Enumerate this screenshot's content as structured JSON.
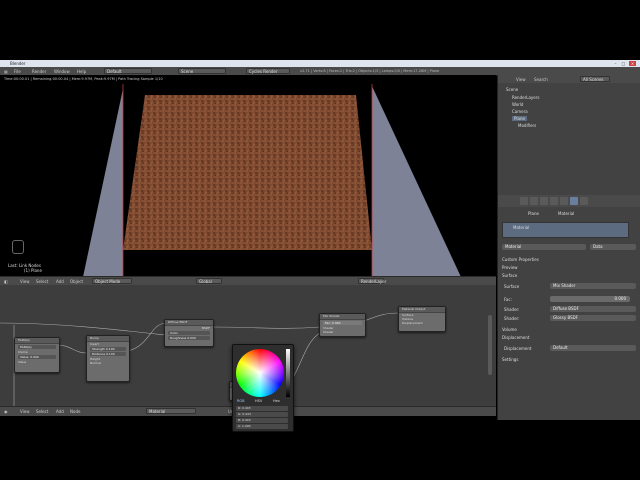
{
  "window": {
    "title": "Blender"
  },
  "topbar": {
    "menus": [
      "File",
      "Render",
      "Window",
      "Help"
    ],
    "layout": "Default",
    "scene": "Scene",
    "engine": "Cycles Render",
    "stats": "v2.71 | Verts:8 | Faces:1 | Tris:2 | Objects:1/3 | Lamps:0/0 | Mem:17.28M | Plane"
  },
  "viewport": {
    "info_line": "Time:00:00.01 | Remaining:00:00.04 | Mem:9.97M, Peak:9.97M | Path Tracing Sample 1/10",
    "last_op": "Last: Link Nodes",
    "object_label": "(1) Plane",
    "header": {
      "menus": [
        "View",
        "Select",
        "Add",
        "Object"
      ],
      "mode": "Object Mode",
      "pivot": "Global",
      "layer": "RenderLayer"
    }
  },
  "node_editor": {
    "nodes": [
      {
        "title": "Diffuse BSDF",
        "out": "BSDF",
        "fields": [
          "Color",
          "Roughness 0.000",
          "Normal"
        ]
      },
      {
        "title": "Mix Shader",
        "out": "Shader",
        "fields": [
          "Fac: 0.360",
          "Shader",
          "Shader"
        ]
      },
      {
        "title": "Material Output",
        "out": "",
        "fields": [
          "Surface",
          "Volume",
          "Displacement"
        ]
      },
      {
        "title": "Multiply",
        "out": "Value",
        "fields": [
          "Multiply",
          "Clamp",
          "Value: 0.000",
          "Value"
        ]
      },
      {
        "title": "Bump",
        "out": "Normal",
        "fields": [
          "Invert",
          "Strength 0.100",
          "Distance 0.100",
          "Height",
          "Normal"
        ]
      },
      {
        "title": "Glossy BSDF",
        "out": "BSDF",
        "fields": [
          "GGX",
          "Roughness 0.200"
        ]
      }
    ],
    "header": {
      "menus": [
        "View",
        "Select",
        "Add",
        "Node"
      ],
      "use_nodes": "Use Nodes",
      "material": "Material"
    }
  },
  "color_picker": {
    "tabs": [
      "RGB",
      "HSV",
      "Hex"
    ],
    "rows": [
      "R: 0.443",
      "G: 0.443",
      "B: 0.443",
      "A: 1.000"
    ]
  },
  "outliner": {
    "header": {
      "view": "View",
      "search": "Search",
      "filter": "All Scenes"
    },
    "items": [
      "Scene",
      "RenderLayers",
      "World",
      "Camera",
      "Plane",
      "Modifiers"
    ]
  },
  "properties": {
    "context": [
      "Plane",
      "Material"
    ],
    "slot": "Material",
    "material_name": "Material",
    "data_label": "Data",
    "sections": [
      "Preview",
      "Surface",
      "Volume",
      "Displacement",
      "Settings"
    ],
    "custom_properties": "Custom Properties",
    "surface_label": "Surface",
    "surface_value": "Mix Shader",
    "fac_label": "Fac:",
    "fac_value": "0.000",
    "shader1_label": "Shader:",
    "shader1_value": "Diffuse BSDF",
    "shader2_label": "Shader:",
    "shader2_value": "Glossy BSDF",
    "displacement_label": "Displacement",
    "displacement_value": "Default"
  }
}
